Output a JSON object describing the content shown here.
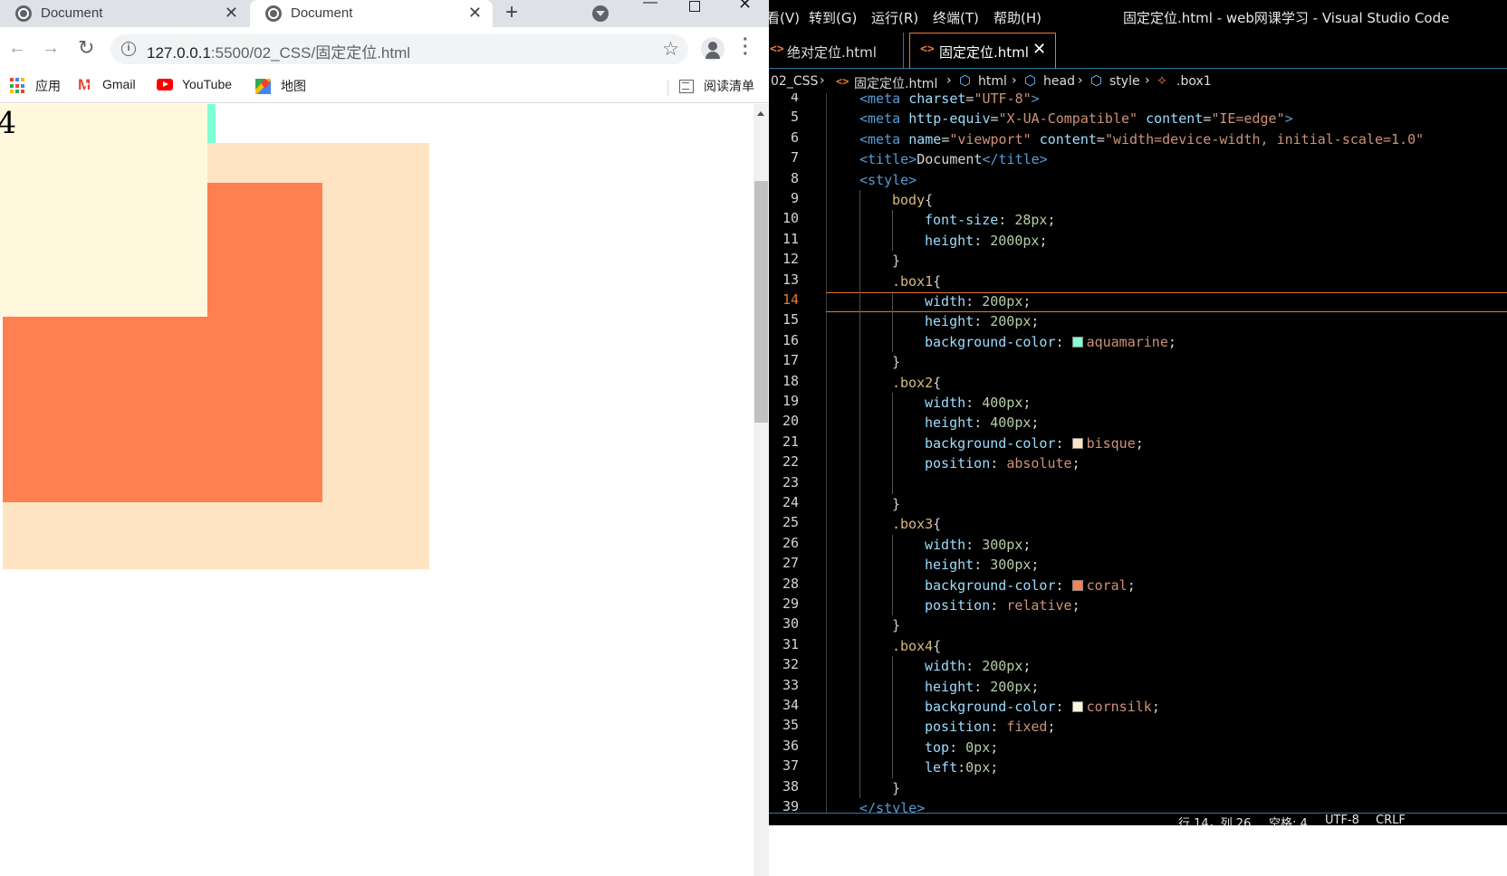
{
  "chrome": {
    "tabs": [
      {
        "title": "Document",
        "active": false
      },
      {
        "title": "Document",
        "active": true
      }
    ],
    "url_host": "127.0.0.1",
    "url_path": ":5500/02_CSS/固定定位.html",
    "bookmarks": {
      "apps": "应用",
      "gmail": "Gmail",
      "youtube": "YouTube",
      "maps": "地图",
      "reading_list": "阅读清单"
    },
    "page": {
      "box4_text": "4",
      "colors": {
        "box1": "#7fffd4",
        "box2": "#ffe4c4",
        "box3": "#ff7f50",
        "box4": "#fff8dc"
      }
    }
  },
  "vscode": {
    "menu": {
      "view": "看(V)",
      "goto": "转到(G)",
      "run": "运行(R)",
      "terminal": "终端(T)",
      "help": "帮助(H)"
    },
    "window_title": "固定定位.html - web网课学习 - Visual Studio Code",
    "tabs": [
      {
        "label": "绝对定位.html"
      },
      {
        "label": "固定定位.html"
      }
    ],
    "breadcrumbs": {
      "dir": "02_CSS",
      "file": "固定定位.html",
      "html": "html",
      "head": "head",
      "style": "style",
      "selector": ".box1"
    },
    "current_line": 14,
    "code_lines": [
      {
        "n": "4",
        "indent": 2,
        "tokens": [
          [
            "tag",
            "<meta "
          ],
          [
            "attr",
            "charset"
          ],
          [
            "punc",
            "="
          ],
          [
            "str",
            "\"UTF-8\""
          ],
          [
            "tag",
            ">"
          ]
        ]
      },
      {
        "n": "5",
        "indent": 2,
        "tokens": [
          [
            "tag",
            "<meta "
          ],
          [
            "attr",
            "http-equiv"
          ],
          [
            "punc",
            "="
          ],
          [
            "str",
            "\"X-UA-Compatible\""
          ],
          [
            "text",
            " "
          ],
          [
            "attr",
            "content"
          ],
          [
            "punc",
            "="
          ],
          [
            "str",
            "\"IE=edge\""
          ],
          [
            "tag",
            ">"
          ]
        ]
      },
      {
        "n": "6",
        "indent": 2,
        "tokens": [
          [
            "tag",
            "<meta "
          ],
          [
            "attr",
            "name"
          ],
          [
            "punc",
            "="
          ],
          [
            "str",
            "\"viewport\""
          ],
          [
            "text",
            " "
          ],
          [
            "attr",
            "content"
          ],
          [
            "punc",
            "="
          ],
          [
            "str",
            "\"width=device-width, initial-scale=1.0\""
          ]
        ]
      },
      {
        "n": "7",
        "indent": 2,
        "tokens": [
          [
            "tag",
            "<title>"
          ],
          [
            "text",
            "Document"
          ],
          [
            "tag",
            "</title>"
          ]
        ]
      },
      {
        "n": "8",
        "indent": 2,
        "tokens": [
          [
            "tag",
            "<style>"
          ]
        ]
      },
      {
        "n": "9",
        "indent": 3,
        "tokens": [
          [
            "sel",
            "body"
          ],
          [
            "punc",
            "{"
          ]
        ]
      },
      {
        "n": "10",
        "indent": 4,
        "tokens": [
          [
            "prop",
            "font-size"
          ],
          [
            "punc",
            ": "
          ],
          [
            "num",
            "28px"
          ],
          [
            "punc",
            ";"
          ]
        ]
      },
      {
        "n": "11",
        "indent": 4,
        "tokens": [
          [
            "prop",
            "height"
          ],
          [
            "punc",
            ": "
          ],
          [
            "num",
            "2000px"
          ],
          [
            "punc",
            ";"
          ]
        ]
      },
      {
        "n": "12",
        "indent": 3,
        "tokens": [
          [
            "punc",
            "}"
          ]
        ]
      },
      {
        "n": "13",
        "indent": 3,
        "tokens": [
          [
            "sel",
            ".box1"
          ],
          [
            "punc",
            "{"
          ]
        ]
      },
      {
        "n": "14",
        "indent": 4,
        "tokens": [
          [
            "prop",
            "width"
          ],
          [
            "punc",
            ": "
          ],
          [
            "num",
            "200px"
          ],
          [
            "punc",
            ";"
          ]
        ]
      },
      {
        "n": "15",
        "indent": 4,
        "tokens": [
          [
            "prop",
            "height"
          ],
          [
            "punc",
            ": "
          ],
          [
            "num",
            "200px"
          ],
          [
            "punc",
            ";"
          ]
        ]
      },
      {
        "n": "16",
        "indent": 4,
        "tokens": [
          [
            "prop",
            "background-color"
          ],
          [
            "punc",
            ": "
          ],
          [
            "swatch",
            "#7fffd4"
          ],
          [
            "val",
            "aquamarine"
          ],
          [
            "punc",
            ";"
          ]
        ]
      },
      {
        "n": "17",
        "indent": 3,
        "tokens": [
          [
            "punc",
            "}"
          ]
        ]
      },
      {
        "n": "18",
        "indent": 3,
        "tokens": [
          [
            "sel",
            ".box2"
          ],
          [
            "punc",
            "{"
          ]
        ]
      },
      {
        "n": "19",
        "indent": 4,
        "tokens": [
          [
            "prop",
            "width"
          ],
          [
            "punc",
            ": "
          ],
          [
            "num",
            "400px"
          ],
          [
            "punc",
            ";"
          ]
        ]
      },
      {
        "n": "20",
        "indent": 4,
        "tokens": [
          [
            "prop",
            "height"
          ],
          [
            "punc",
            ": "
          ],
          [
            "num",
            "400px"
          ],
          [
            "punc",
            ";"
          ]
        ]
      },
      {
        "n": "21",
        "indent": 4,
        "tokens": [
          [
            "prop",
            "background-color"
          ],
          [
            "punc",
            ": "
          ],
          [
            "swatch",
            "#ffe4c4"
          ],
          [
            "val",
            "bisque"
          ],
          [
            "punc",
            ";"
          ]
        ]
      },
      {
        "n": "22",
        "indent": 4,
        "tokens": [
          [
            "prop",
            "position"
          ],
          [
            "punc",
            ": "
          ],
          [
            "val",
            "absolute"
          ],
          [
            "punc",
            ";"
          ]
        ]
      },
      {
        "n": "23",
        "indent": 4,
        "tokens": []
      },
      {
        "n": "24",
        "indent": 3,
        "tokens": [
          [
            "punc",
            "}"
          ]
        ]
      },
      {
        "n": "25",
        "indent": 3,
        "tokens": [
          [
            "sel",
            ".box3"
          ],
          [
            "punc",
            "{"
          ]
        ]
      },
      {
        "n": "26",
        "indent": 4,
        "tokens": [
          [
            "prop",
            "width"
          ],
          [
            "punc",
            ": "
          ],
          [
            "num",
            "300px"
          ],
          [
            "punc",
            ";"
          ]
        ]
      },
      {
        "n": "27",
        "indent": 4,
        "tokens": [
          [
            "prop",
            "height"
          ],
          [
            "punc",
            ": "
          ],
          [
            "num",
            "300px"
          ],
          [
            "punc",
            ";"
          ]
        ]
      },
      {
        "n": "28",
        "indent": 4,
        "tokens": [
          [
            "prop",
            "background-color"
          ],
          [
            "punc",
            ": "
          ],
          [
            "swatch",
            "#ff7f50"
          ],
          [
            "val",
            "coral"
          ],
          [
            "punc",
            ";"
          ]
        ]
      },
      {
        "n": "29",
        "indent": 4,
        "tokens": [
          [
            "prop",
            "position"
          ],
          [
            "punc",
            ": "
          ],
          [
            "val",
            "relative"
          ],
          [
            "punc",
            ";"
          ]
        ]
      },
      {
        "n": "30",
        "indent": 3,
        "tokens": [
          [
            "punc",
            "}"
          ]
        ]
      },
      {
        "n": "31",
        "indent": 3,
        "tokens": [
          [
            "sel",
            ".box4"
          ],
          [
            "punc",
            "{"
          ]
        ]
      },
      {
        "n": "32",
        "indent": 4,
        "tokens": [
          [
            "prop",
            "width"
          ],
          [
            "punc",
            ": "
          ],
          [
            "num",
            "200px"
          ],
          [
            "punc",
            ";"
          ]
        ]
      },
      {
        "n": "33",
        "indent": 4,
        "tokens": [
          [
            "prop",
            "height"
          ],
          [
            "punc",
            ": "
          ],
          [
            "num",
            "200px"
          ],
          [
            "punc",
            ";"
          ]
        ]
      },
      {
        "n": "34",
        "indent": 4,
        "tokens": [
          [
            "prop",
            "background-color"
          ],
          [
            "punc",
            ": "
          ],
          [
            "swatch",
            "#fff8dc"
          ],
          [
            "val",
            "cornsilk"
          ],
          [
            "punc",
            ";"
          ]
        ]
      },
      {
        "n": "35",
        "indent": 4,
        "tokens": [
          [
            "prop",
            "position"
          ],
          [
            "punc",
            ": "
          ],
          [
            "val",
            "fixed"
          ],
          [
            "punc",
            ";"
          ]
        ]
      },
      {
        "n": "36",
        "indent": 4,
        "tokens": [
          [
            "prop",
            "top"
          ],
          [
            "punc",
            ": "
          ],
          [
            "num",
            "0px"
          ],
          [
            "punc",
            ";"
          ]
        ]
      },
      {
        "n": "37",
        "indent": 4,
        "tokens": [
          [
            "prop",
            "left"
          ],
          [
            "punc",
            ":"
          ],
          [
            "num",
            "0px"
          ],
          [
            "punc",
            ";"
          ]
        ]
      },
      {
        "n": "38",
        "indent": 3,
        "tokens": [
          [
            "punc",
            "}"
          ]
        ]
      },
      {
        "n": "39",
        "indent": 2,
        "tokens": [
          [
            "tag",
            "</style>"
          ]
        ]
      }
    ],
    "status": {
      "position": "行 14，列 26",
      "spaces": "空格: 4",
      "encoding": "UTF-8",
      "eol": "CRLF"
    }
  }
}
